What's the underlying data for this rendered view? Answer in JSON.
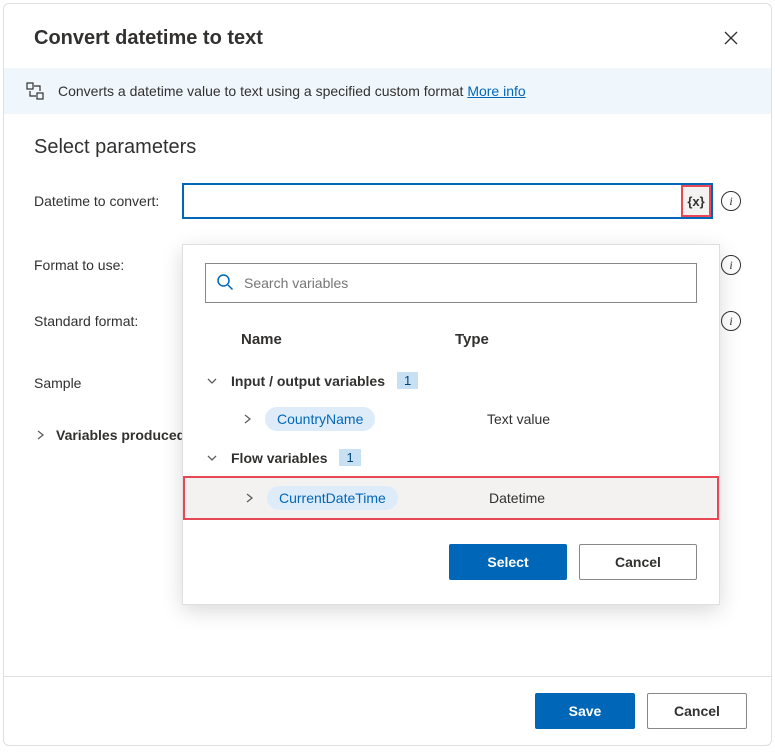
{
  "dialog": {
    "title": "Convert datetime to text",
    "banner": {
      "text": "Converts a datetime value to text using a specified custom format ",
      "link": "More info"
    },
    "section_title": "Select parameters",
    "params": {
      "datetime_label": "Datetime to convert:",
      "format_label": "Format to use:",
      "standard_label": "Standard format:",
      "sample_label": "Sample",
      "vars_produced_label": "Variables produced"
    },
    "var_btn": "{x}",
    "info_glyph": "i"
  },
  "dropdown": {
    "search_placeholder": "Search variables",
    "headers": {
      "name": "Name",
      "type": "Type"
    },
    "groups": [
      {
        "label": "Input / output variables",
        "count": "1"
      },
      {
        "label": "Flow variables",
        "count": "1"
      }
    ],
    "variables": [
      {
        "name": "CountryName",
        "type": "Text value"
      },
      {
        "name": "CurrentDateTime",
        "type": "Datetime"
      }
    ],
    "buttons": {
      "select": "Select",
      "cancel": "Cancel"
    }
  },
  "footer": {
    "save": "Save",
    "cancel": "Cancel"
  }
}
